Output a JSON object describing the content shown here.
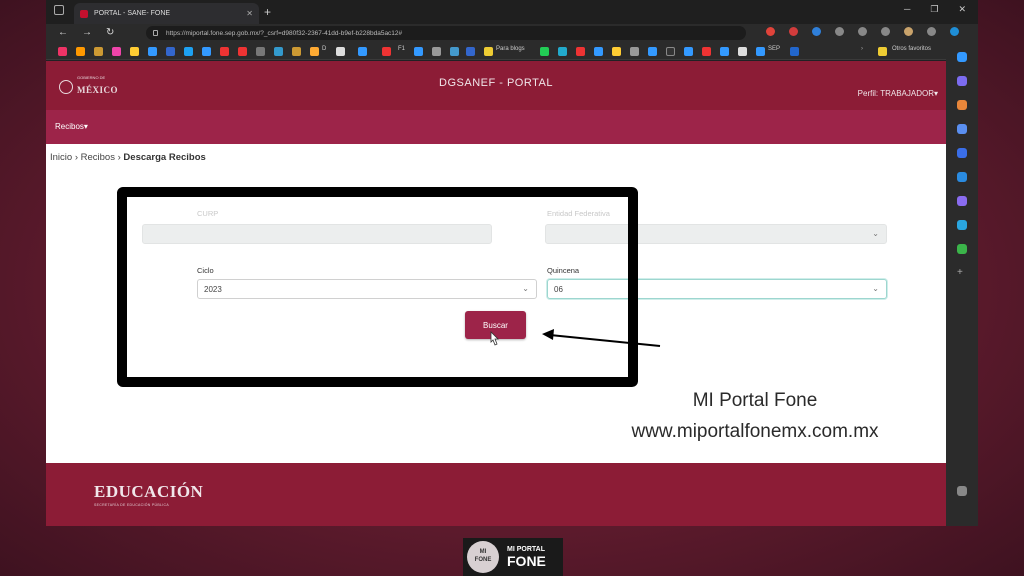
{
  "browser": {
    "tab_title": "PORTAL - SANE- FONE",
    "url": "https://miportal.fone.sep.gob.mx/?_csrf=d980f32-2367-41dd-b9ef-b228bda5ac12#",
    "bookmarks": [
      "D",
      "F1",
      "Para blogs",
      "SEP",
      "Otros favoritos"
    ]
  },
  "header": {
    "gob_small": "GOBIERNO DE",
    "gob_big": "MÉXICO",
    "title": "DGSANEF - PORTAL",
    "perfil": "Perfil: TRABAJADOR"
  },
  "menu": {
    "recibos": "Recibos"
  },
  "breadcrumb": {
    "inicio": "Inicio",
    "recibos": "Recibos",
    "current": "Descarga Recibos"
  },
  "form": {
    "curp_label": "CURP",
    "curp_value": "",
    "entidad_label": "Entidad Federativa",
    "entidad_value": "",
    "ciclo_label": "Ciclo",
    "ciclo_value": "2023",
    "quincena_label": "Quincena",
    "quincena_value": "06",
    "buscar_label": "Buscar"
  },
  "footer": {
    "brand": "EDUCACIÓN",
    "sub": "SECRETARÍA DE EDUCACIÓN PÚBLICA"
  },
  "overlay": {
    "line1": "MI Portal Fone",
    "line2": "www.miportalfonemx.com.mx"
  },
  "logo": {
    "circle_line1": "MI",
    "circle_line2": "FONE",
    "text_line1": "MI PORTAL",
    "text_line2": "FONE"
  },
  "colors": {
    "brand_dark": "#8c1c36",
    "brand": "#9d2449"
  }
}
